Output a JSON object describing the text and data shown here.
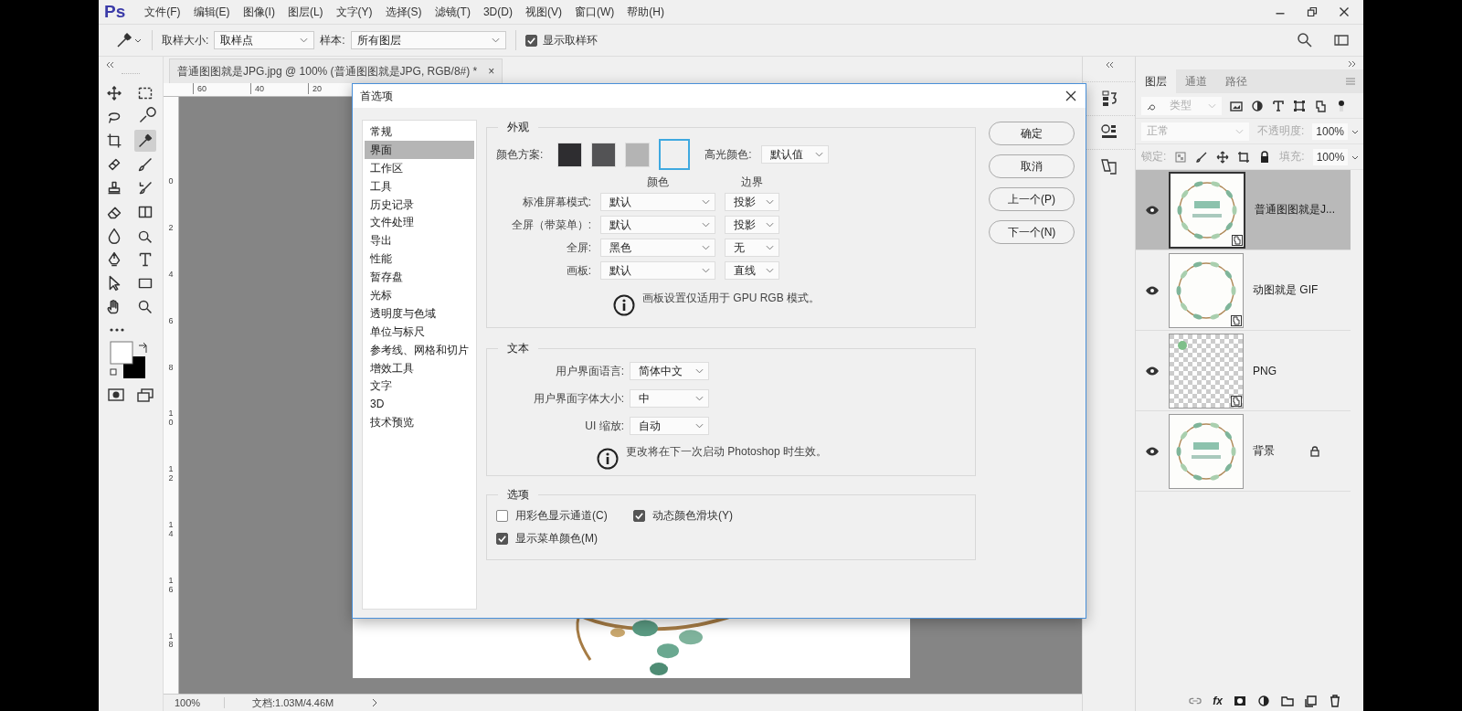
{
  "app": {
    "logo": "Ps",
    "menu": [
      "文件(F)",
      "编辑(E)",
      "图像(I)",
      "图层(L)",
      "文字(Y)",
      "选择(S)",
      "滤镜(T)",
      "3D(D)",
      "视图(V)",
      "窗口(W)",
      "帮助(H)"
    ]
  },
  "options_bar": {
    "sample_size_label": "取样大小:",
    "sample_size": "取样点",
    "sample_label": "样本:",
    "sample": "所有图层",
    "show_ring": {
      "label": "显示取样环",
      "checked": true
    }
  },
  "toolbox": {
    "tools": [
      {
        "selected": false
      },
      {
        "selected": false
      },
      {
        "selected": false
      },
      {
        "selected": false
      },
      {
        "selected": false
      },
      {
        "selected": true
      },
      {
        "selected": false
      },
      {
        "selected": false
      },
      {
        "selected": false
      },
      {
        "selected": false
      },
      {
        "selected": false
      },
      {
        "selected": false
      },
      {
        "selected": false
      },
      {
        "selected": false
      },
      {
        "selected": false
      },
      {
        "selected": false
      },
      {
        "selected": false
      },
      {
        "selected": false
      },
      {
        "selected": false
      },
      {
        "selected": false
      }
    ]
  },
  "document": {
    "tab_title": "普通图图就是JPG.jpg @ 100% (普通图图就是JPG, RGB/8#) *",
    "tab_close": "×",
    "ruler_h": [
      "60",
      "40",
      "20"
    ],
    "ruler_v": [
      "0",
      "2",
      "4",
      "6",
      "8",
      "10",
      "12",
      "14",
      "16",
      "18"
    ]
  },
  "status_bar": {
    "zoom": "100%",
    "doc_info": "文档:1.03M/4.46M"
  },
  "dialog": {
    "title": "首选项",
    "sidebar": [
      {
        "label": "常规",
        "selected": false
      },
      {
        "label": "界面",
        "selected": true
      },
      {
        "label": "工作区",
        "selected": false
      },
      {
        "label": "工具",
        "selected": false
      },
      {
        "label": "历史记录",
        "selected": false
      },
      {
        "label": "文件处理",
        "selected": false
      },
      {
        "label": "导出",
        "selected": false
      },
      {
        "label": "性能",
        "selected": false
      },
      {
        "label": "暂存盘",
        "selected": false
      },
      {
        "label": "光标",
        "selected": false
      },
      {
        "label": "透明度与色域",
        "selected": false
      },
      {
        "label": "单位与标尺",
        "selected": false
      },
      {
        "label": "参考线、网格和切片",
        "selected": false
      },
      {
        "label": "增效工具",
        "selected": false
      },
      {
        "label": "文字",
        "selected": false
      },
      {
        "label": "3D",
        "selected": false
      },
      {
        "label": "技术预览",
        "selected": false
      }
    ],
    "appearance": {
      "legend": "外观",
      "scheme_label": "颜色方案:",
      "schemes": [
        {
          "color": "#2e2d30",
          "selected": false
        },
        {
          "color": "#535355",
          "selected": false
        },
        {
          "color": "#b4b4b4",
          "selected": false
        },
        {
          "color": "#f0f0f0",
          "selected": true
        }
      ],
      "highlight_label": "高光颜色:",
      "highlight": "默认值",
      "col_color": "颜色",
      "col_border": "边界",
      "rows": [
        {
          "label": "标准屏幕模式:",
          "color_mode": "默认",
          "border": "投影"
        },
        {
          "label": "全屏（带菜单）:",
          "color_mode": "默认",
          "border": "投影"
        },
        {
          "label": "全屏:",
          "color_mode": "黑色",
          "border": "无"
        },
        {
          "label": "画板:",
          "color_mode": "默认",
          "border": "直线"
        }
      ],
      "note": "画板设置仅适用于 GPU RGB 模式。"
    },
    "text": {
      "legend": "文本",
      "rows": [
        {
          "label": "用户界面语言:",
          "value": "简体中文"
        },
        {
          "label": "用户界面字体大小:",
          "value": "中"
        },
        {
          "label": "UI 缩放:",
          "value": "自动"
        }
      ],
      "note": "更改将在下一次启动 Photoshop 时生效。"
    },
    "options": {
      "legend": "选项",
      "checks": [
        {
          "label": "用彩色显示通道(C)",
          "checked": false
        },
        {
          "label": "动态颜色滑块(Y)",
          "checked": true
        },
        {
          "label": "显示菜单颜色(M)",
          "checked": true
        }
      ]
    },
    "buttons": [
      "确定",
      "取消",
      "上一个(P)",
      "下一个(N)"
    ]
  },
  "layers_panel": {
    "tabs": [
      {
        "label": "图层",
        "selected": true
      },
      {
        "label": "通道",
        "selected": false
      },
      {
        "label": "路径",
        "selected": false
      }
    ],
    "filter": "类型",
    "blend": "正常",
    "opacity_label": "不透明度:",
    "opacity": "100%",
    "lock_label": "锁定:",
    "fill_label": "填充:",
    "fill": "100%",
    "fx": "fx",
    "layers": [
      {
        "name": "普通图图就是J...",
        "kind": "wreath",
        "selected": true,
        "visible": true,
        "smart": true,
        "locked": false
      },
      {
        "name": "动图就是 GIF",
        "kind": "ring",
        "selected": false,
        "visible": true,
        "smart": true,
        "locked": false
      },
      {
        "name": "PNG",
        "kind": "transparent",
        "selected": false,
        "visible": true,
        "smart": true,
        "locked": false
      },
      {
        "name": "背景",
        "kind": "wreath",
        "selected": false,
        "visible": true,
        "smart": false,
        "locked": true
      }
    ]
  }
}
